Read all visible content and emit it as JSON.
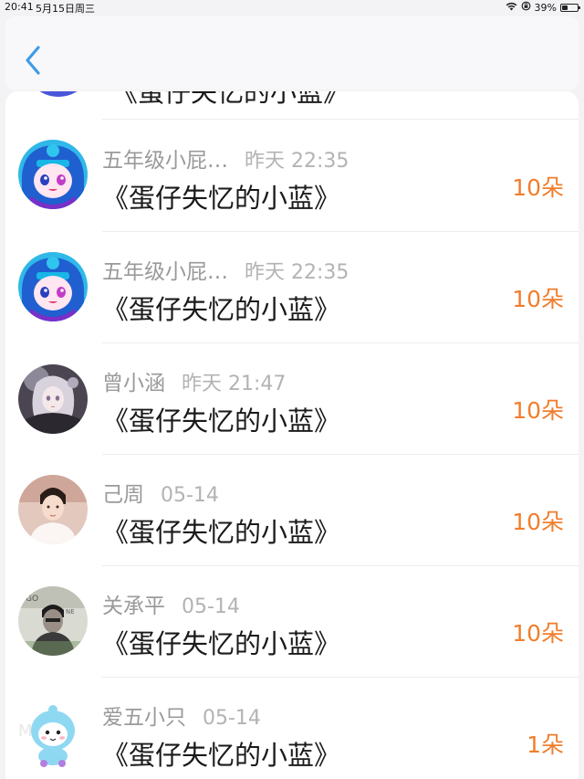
{
  "status_bar": {
    "time": "20:41",
    "date": "5月15日周三",
    "battery": "39%",
    "battery_level": 0.39
  },
  "header": {
    "back_icon": "chevron-left-icon"
  },
  "list": {
    "partial_item": {
      "title": "《蛋仔失忆的小蓝》"
    },
    "items": [
      {
        "name": "五年级小屁…",
        "time": "昨天 22:35",
        "title": "《蛋仔失忆的小蓝》",
        "count": "10朵",
        "avatar": "anime-avatar-blue-hood"
      },
      {
        "name": "五年级小屁…",
        "time": "昨天 22:35",
        "title": "《蛋仔失忆的小蓝》",
        "count": "10朵",
        "avatar": "anime-avatar-blue-hood"
      },
      {
        "name": "曾小涵",
        "time": "昨天 21:47",
        "title": "《蛋仔失忆的小蓝》",
        "count": "10朵",
        "avatar": "anime-girl-avatar"
      },
      {
        "name": "己周",
        "time": "05-14",
        "title": "《蛋仔失忆的小蓝》",
        "count": "10朵",
        "avatar": "person-photo-avatar"
      },
      {
        "name": "关承平",
        "time": "05-14",
        "title": "《蛋仔失忆的小蓝》",
        "count": "10朵",
        "avatar": "person-photo-avatar-grey"
      },
      {
        "name": "爱五小只",
        "time": "05-14",
        "title": "《蛋仔失忆的小蓝》",
        "count": "1朵",
        "avatar": "cartoon-mascot-avatar"
      }
    ]
  },
  "colors": {
    "accent_blue": "#3d9be9",
    "count_orange": "#f07e2c",
    "name_grey": "#9a9a9a",
    "time_grey": "#b3b3b3"
  }
}
